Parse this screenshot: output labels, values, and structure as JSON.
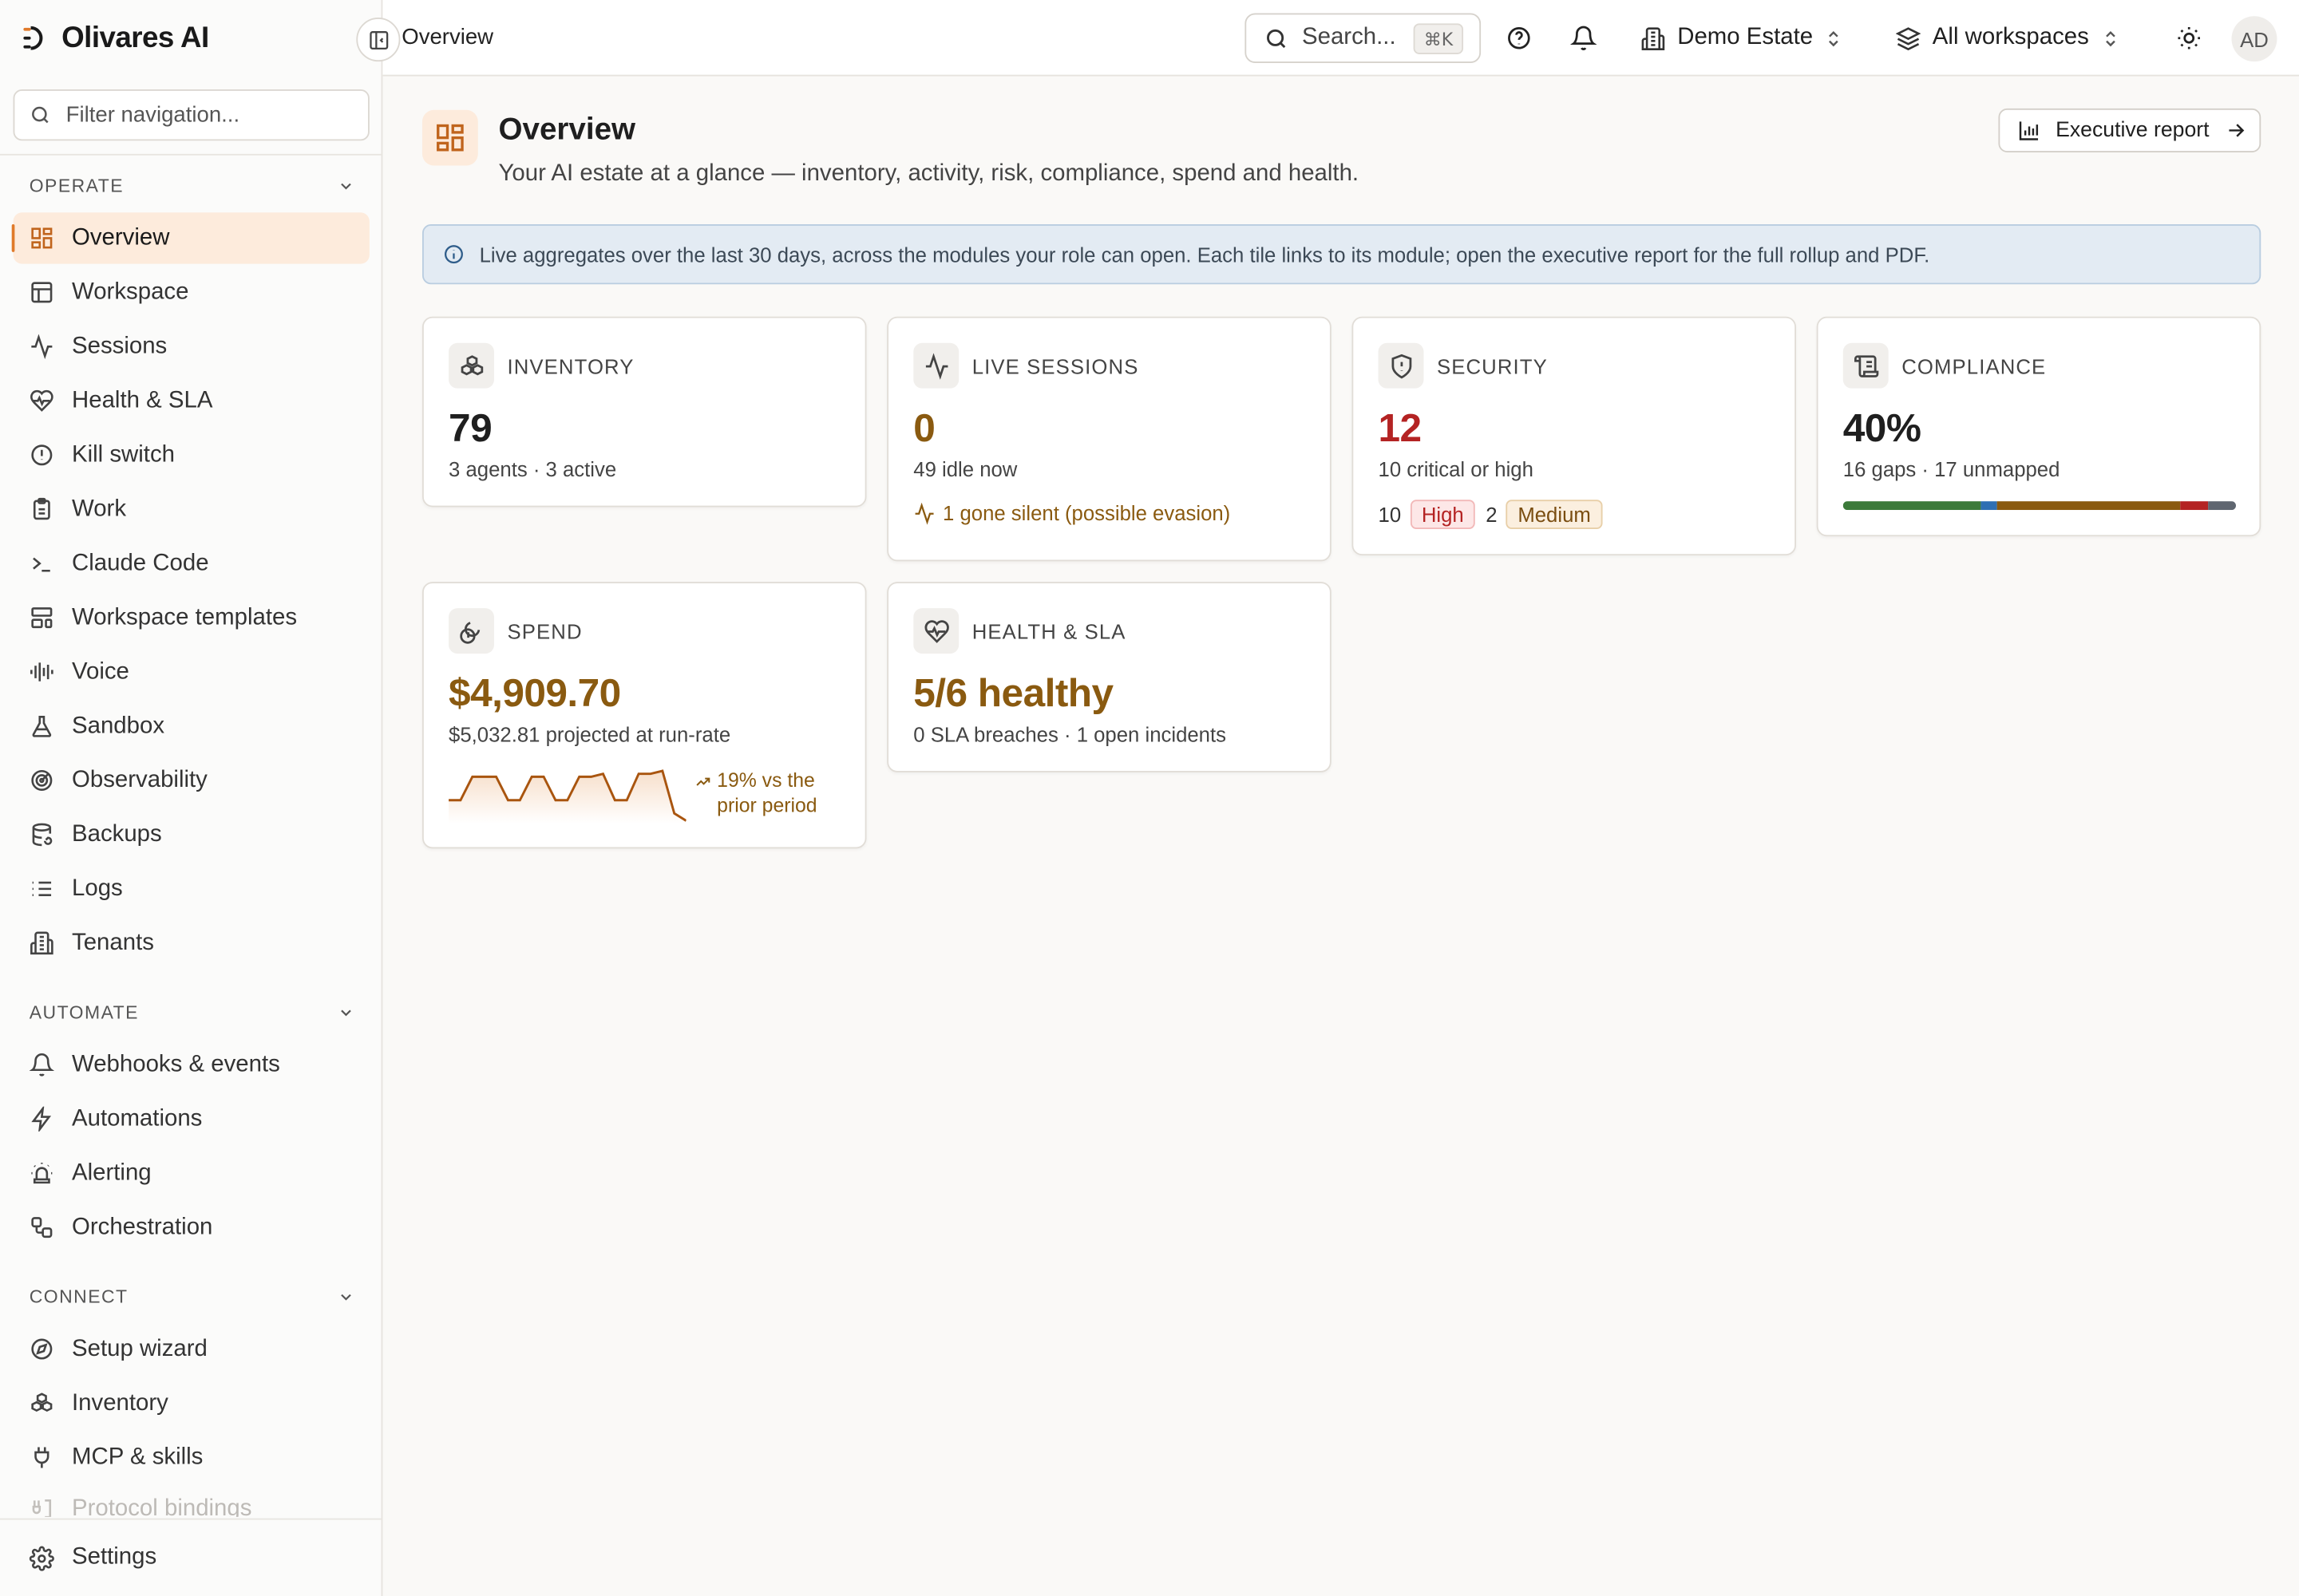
{
  "brand": {
    "name": "Olivares AI"
  },
  "sidebar": {
    "filter_placeholder": "Filter navigation...",
    "sections": [
      {
        "title": "OPERATE",
        "items": [
          {
            "label": "Overview",
            "icon": "grid-icon",
            "active": true
          },
          {
            "label": "Workspace",
            "icon": "layout-icon"
          },
          {
            "label": "Sessions",
            "icon": "activity-icon"
          },
          {
            "label": "Health & SLA",
            "icon": "heart-pulse-icon"
          },
          {
            "label": "Kill switch",
            "icon": "alert-circle-icon"
          },
          {
            "label": "Work",
            "icon": "clipboard-icon"
          },
          {
            "label": "Claude Code",
            "icon": "terminal-icon"
          },
          {
            "label": "Workspace templates",
            "icon": "template-icon"
          },
          {
            "label": "Voice",
            "icon": "audio-wave-icon"
          },
          {
            "label": "Sandbox",
            "icon": "flask-icon"
          },
          {
            "label": "Observability",
            "icon": "radar-icon"
          },
          {
            "label": "Backups",
            "icon": "database-backup-icon"
          },
          {
            "label": "Logs",
            "icon": "list-icon"
          },
          {
            "label": "Tenants",
            "icon": "building-icon"
          }
        ]
      },
      {
        "title": "AUTOMATE",
        "items": [
          {
            "label": "Webhooks & events",
            "icon": "bell-icon"
          },
          {
            "label": "Automations",
            "icon": "zap-icon"
          },
          {
            "label": "Alerting",
            "icon": "siren-icon"
          },
          {
            "label": "Orchestration",
            "icon": "workflow-icon"
          }
        ]
      },
      {
        "title": "CONNECT",
        "items": [
          {
            "label": "Setup wizard",
            "icon": "compass-icon"
          },
          {
            "label": "Inventory",
            "icon": "boxes-icon"
          },
          {
            "label": "MCP & skills",
            "icon": "plug-icon"
          },
          {
            "label": "Protocol bindings",
            "icon": "binding-icon"
          }
        ]
      }
    ],
    "settings_label": "Settings"
  },
  "header": {
    "title": "Overview",
    "search_placeholder": "Search...",
    "search_shortcut": "⌘K",
    "estate": "Demo Estate",
    "workspace": "All workspaces",
    "avatar": "AD"
  },
  "page": {
    "title": "Overview",
    "subtitle": "Your AI estate at a glance — inventory, activity, risk, compliance, spend and health.",
    "exec_report": "Executive report",
    "info": "Live aggregates over the last 30 days, across the modules your role can open. Each tile links to its module; open the executive report for the full rollup and PDF."
  },
  "cards": {
    "inventory": {
      "label": "INVENTORY",
      "value": "79",
      "sub": "3 agents · 3 active"
    },
    "sessions": {
      "label": "LIVE SESSIONS",
      "value": "0",
      "sub": "49 idle now",
      "note": "1 gone silent (possible evasion)"
    },
    "security": {
      "label": "SECURITY",
      "value": "12",
      "sub": "10 critical or high",
      "high_count": "10",
      "high_label": "High",
      "med_count": "2",
      "med_label": "Medium"
    },
    "compliance": {
      "label": "COMPLIANCE",
      "value": "40%",
      "sub": "16 gaps · 17 unmapped",
      "bar": [
        {
          "color": "#3c7a3a",
          "fraction": 0.35
        },
        {
          "color": "#2f6fb3",
          "fraction": 0.04
        },
        {
          "color": "#8a5a10",
          "fraction": 0.47
        },
        {
          "color": "#b42323",
          "fraction": 0.07
        },
        {
          "color": "#5f6670",
          "fraction": 0.07
        }
      ]
    },
    "spend": {
      "label": "SPEND",
      "value": "$4,909.70",
      "sub": "$5,032.81 projected at run-rate",
      "trend_line1": "19% vs the",
      "trend_line2": "prior period",
      "spark": [
        14,
        14,
        30,
        30,
        30,
        14,
        14,
        30,
        30,
        14,
        14,
        30,
        30,
        32,
        14,
        14,
        32,
        32,
        34,
        5,
        0
      ]
    },
    "health": {
      "label": "HEALTH & SLA",
      "value": "5/6 healthy",
      "sub": "0 SLA breaches · 1 open incidents"
    }
  },
  "colors": {
    "accent": "#e07a2a",
    "amber": "#8a5a10",
    "danger": "#b42323"
  }
}
